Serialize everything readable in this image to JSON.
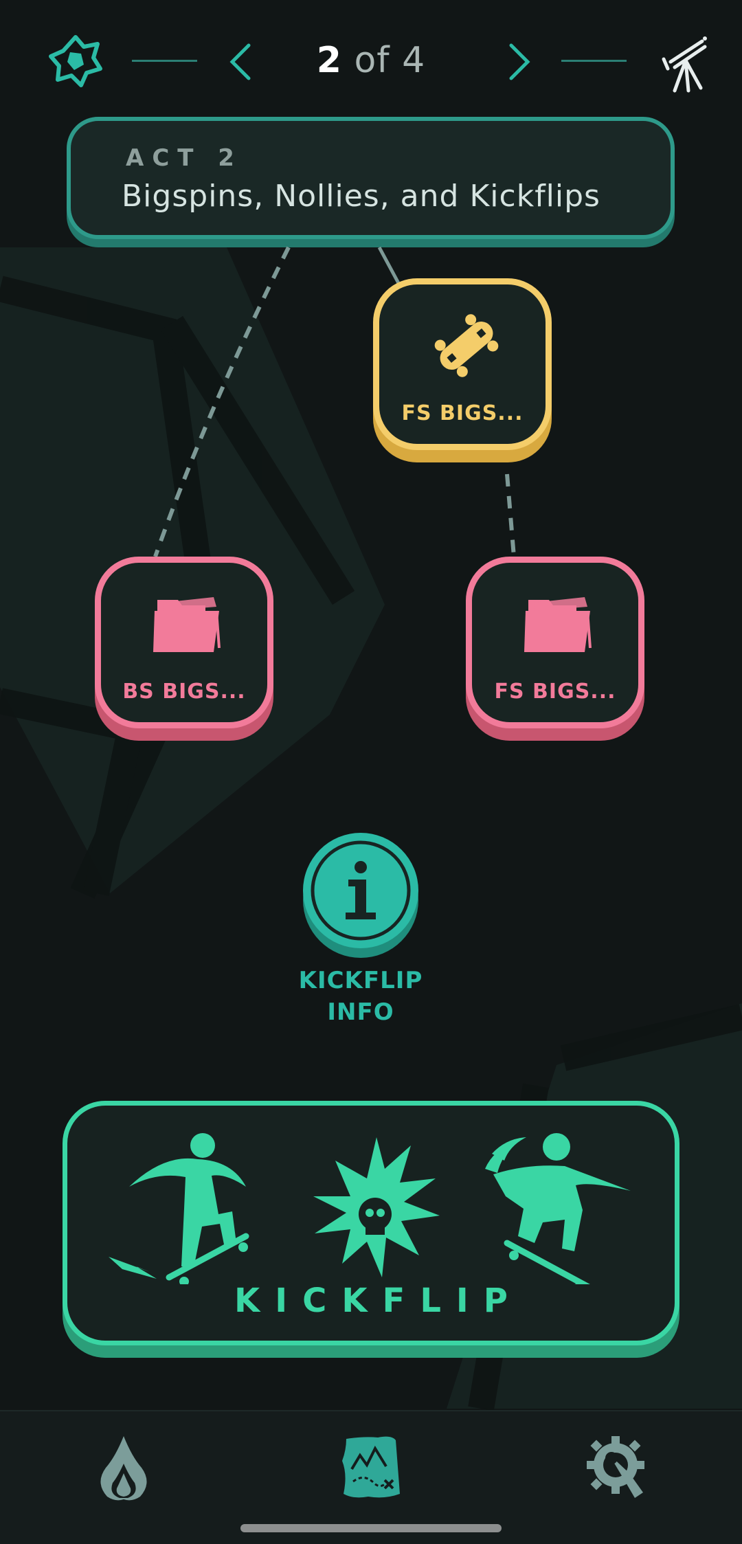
{
  "nav": {
    "current": "2",
    "of": "of",
    "total": "4",
    "logo_icon": "spiky-badge-icon",
    "prev_icon": "chevron-left-icon",
    "next_icon": "chevron-right-icon",
    "telescope_icon": "telescope-icon"
  },
  "act": {
    "label": "ACT 2",
    "title": "Bigspins, Nollies, and Kickflips"
  },
  "nodes": [
    {
      "label": "FS BIGS...",
      "icon": "skateboard-icon",
      "color": "#f4cd6a"
    },
    {
      "label": "BS BIGS...",
      "icon": "folder-icon",
      "color": "#f27b9a"
    },
    {
      "label": "FS BIGS...",
      "icon": "folder-icon",
      "color": "#f27b9a"
    }
  ],
  "info": {
    "line1": "KICKFLIP",
    "line2": "INFO",
    "icon": "info-icon"
  },
  "trick_card": {
    "name": "KICKFLIP",
    "icons": [
      "skater-landing-icon",
      "skull-burst-icon",
      "skater-flip-icon"
    ]
  },
  "tabs": [
    {
      "icon": "flame-icon"
    },
    {
      "icon": "treasure-map-icon"
    },
    {
      "icon": "settings-wrench-icon"
    }
  ],
  "colors": {
    "background": "#111616",
    "teal": "#2bbba6",
    "green": "#3ad6a4",
    "yellow": "#f4cd6a",
    "pink": "#f27b9a"
  }
}
